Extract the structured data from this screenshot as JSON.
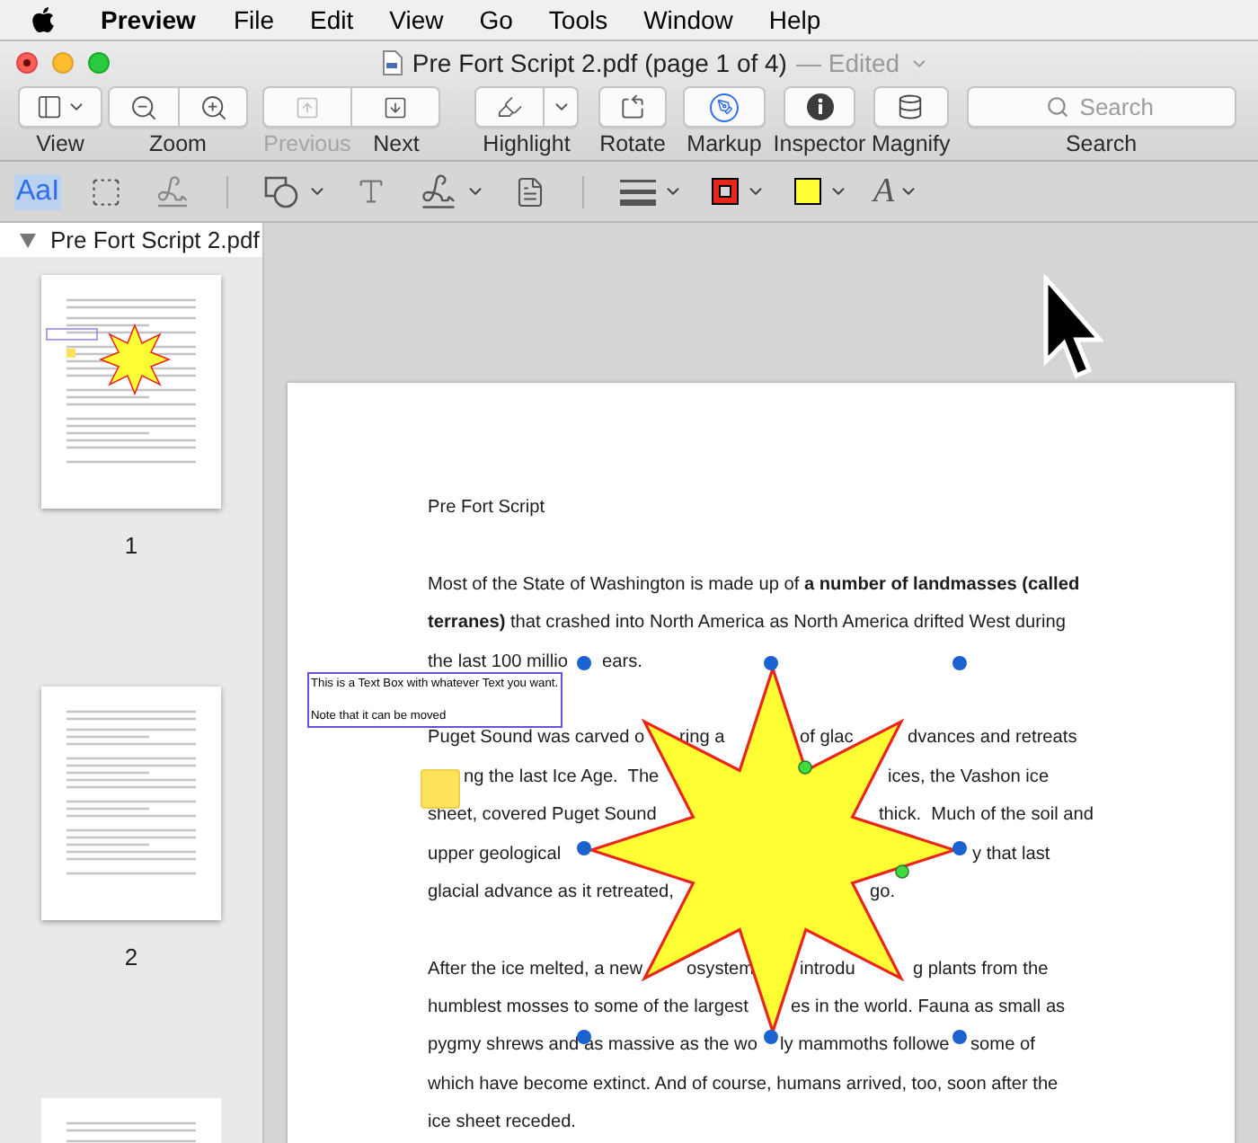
{
  "menu_bar": {
    "app": "Preview",
    "items": [
      "File",
      "Edit",
      "View",
      "Go",
      "Tools",
      "Window",
      "Help"
    ]
  },
  "window": {
    "title": "Pre Fort Script 2.pdf (page 1 of 4)",
    "status": "— Edited"
  },
  "toolbar": {
    "view": {
      "label": "View"
    },
    "zoom": {
      "label": "Zoom"
    },
    "previous": {
      "label": "Previous",
      "disabled": true
    },
    "next": {
      "label": "Next",
      "disabled": false
    },
    "highlight": {
      "label": "Highlight"
    },
    "rotate": {
      "label": "Rotate"
    },
    "markup": {
      "label": "Markup",
      "active": true
    },
    "inspector": {
      "label": "Inspector"
    },
    "magnify": {
      "label": "Magnify"
    },
    "search": {
      "label": "Search",
      "placeholder": "Search"
    }
  },
  "markup_tools": [
    {
      "kind": "text_select",
      "label": "AaI",
      "selected": true
    },
    {
      "kind": "rect_select",
      "selected": false
    },
    {
      "kind": "sketch",
      "selected": false
    },
    {
      "kind": "shapes",
      "selected": false
    },
    {
      "kind": "text_box",
      "selected": false
    },
    {
      "kind": "sign",
      "selected": false
    },
    {
      "kind": "note",
      "selected": false
    },
    {
      "kind": "line_style",
      "selected": false
    },
    {
      "kind": "border_color",
      "color": "#e8261c",
      "selected": false
    },
    {
      "kind": "fill_color",
      "color": "#ffff33",
      "selected": false
    },
    {
      "kind": "text_style",
      "label": "A",
      "selected": false
    }
  ],
  "sidebar": {
    "document": "Pre Fort Script 2.pdf",
    "expanded": true,
    "pages": [
      {
        "label": "1"
      },
      {
        "label": "2"
      }
    ]
  },
  "document": {
    "title": "Pre Fort Script",
    "paragraphs": [
      {
        "lines": [
          [
            "Most of the State of Washington is made up of **a number of landmasses (called**"
          ],
          [
            "**terranes)** that crashed into North America as North America drifted West during"
          ],
          [
            "the last 100 millio",
            "ears."
          ]
        ]
      },
      {
        "lines": [
          [
            "Puget Sound was carved o",
            "ring a",
            "of glac",
            "dvances and retreats"
          ],
          [
            "ng the last Ice Age.  The",
            "ices, the Vashon ice"
          ],
          [
            "sheet, covered Puget Sound",
            "thick.  Much of the soil and"
          ],
          [
            "upper geological",
            "y that last"
          ],
          [
            "glacial advance as it retreated,",
            "go."
          ]
        ]
      },
      {
        "lines": [
          [
            "After the ice melted, a new",
            "osystem",
            "introdu",
            "g plants from the"
          ],
          [
            "humblest mosses to some of the largest",
            "es in the world. Fauna as small as"
          ],
          [
            "pygmy shrews and as massive as the wo",
            "ly mammoths followe",
            "some of"
          ],
          [
            "which have become extinct. And of course, humans arrived, too, soon after the"
          ],
          [
            "ice sheet receded."
          ]
        ]
      }
    ]
  },
  "text_box": {
    "lines": [
      "This is a Text Box with whatever Text you want.",
      "Note that it can be moved"
    ]
  }
}
